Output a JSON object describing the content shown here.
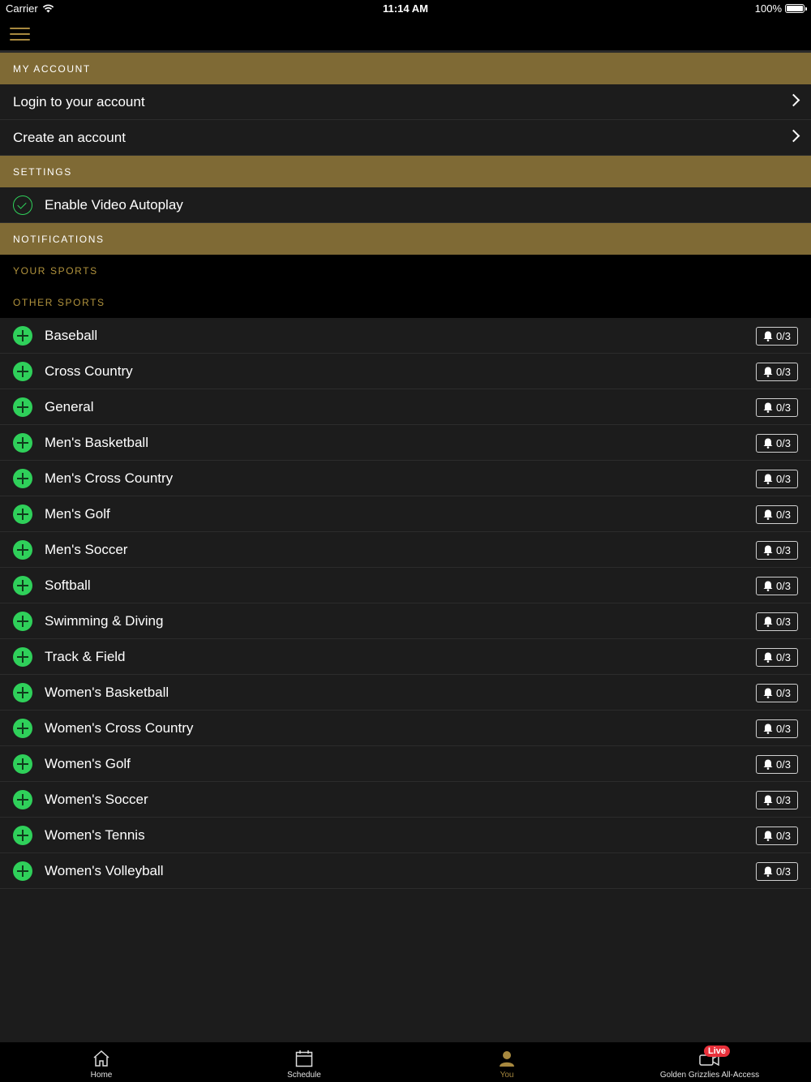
{
  "status_bar": {
    "carrier": "Carrier",
    "time": "11:14 AM",
    "battery": "100%"
  },
  "sections": {
    "my_account": "MY ACCOUNT",
    "settings": "SETTINGS",
    "notifications": "NOTIFICATIONS",
    "your_sports": "YOUR SPORTS",
    "other_sports": "OTHER SPORTS"
  },
  "account": {
    "login": "Login to your account",
    "create": "Create an account"
  },
  "settings": {
    "autoplay": "Enable Video Autoplay"
  },
  "sports": [
    {
      "name": "Baseball",
      "count": "0/3"
    },
    {
      "name": "Cross Country",
      "count": "0/3"
    },
    {
      "name": "General",
      "count": "0/3"
    },
    {
      "name": "Men's Basketball",
      "count": "0/3"
    },
    {
      "name": "Men's Cross Country",
      "count": "0/3"
    },
    {
      "name": "Men's Golf",
      "count": "0/3"
    },
    {
      "name": "Men's Soccer",
      "count": "0/3"
    },
    {
      "name": "Softball",
      "count": "0/3"
    },
    {
      "name": "Swimming & Diving",
      "count": "0/3"
    },
    {
      "name": "Track & Field",
      "count": "0/3"
    },
    {
      "name": "Women's Basketball",
      "count": "0/3"
    },
    {
      "name": "Women's Cross Country",
      "count": "0/3"
    },
    {
      "name": "Women's Golf",
      "count": "0/3"
    },
    {
      "name": "Women's Soccer",
      "count": "0/3"
    },
    {
      "name": "Women's Tennis",
      "count": "0/3"
    },
    {
      "name": "Women's Volleyball",
      "count": "0/3"
    }
  ],
  "tabs": {
    "home": "Home",
    "schedule": "Schedule",
    "you": "You",
    "all_access": "Golden Grizzlies All-Access",
    "live_badge": "Live"
  },
  "colors": {
    "gold": "#7f6a35",
    "accent_gold": "#a8893f",
    "green": "#2fd05a",
    "live_red": "#e8303a"
  }
}
